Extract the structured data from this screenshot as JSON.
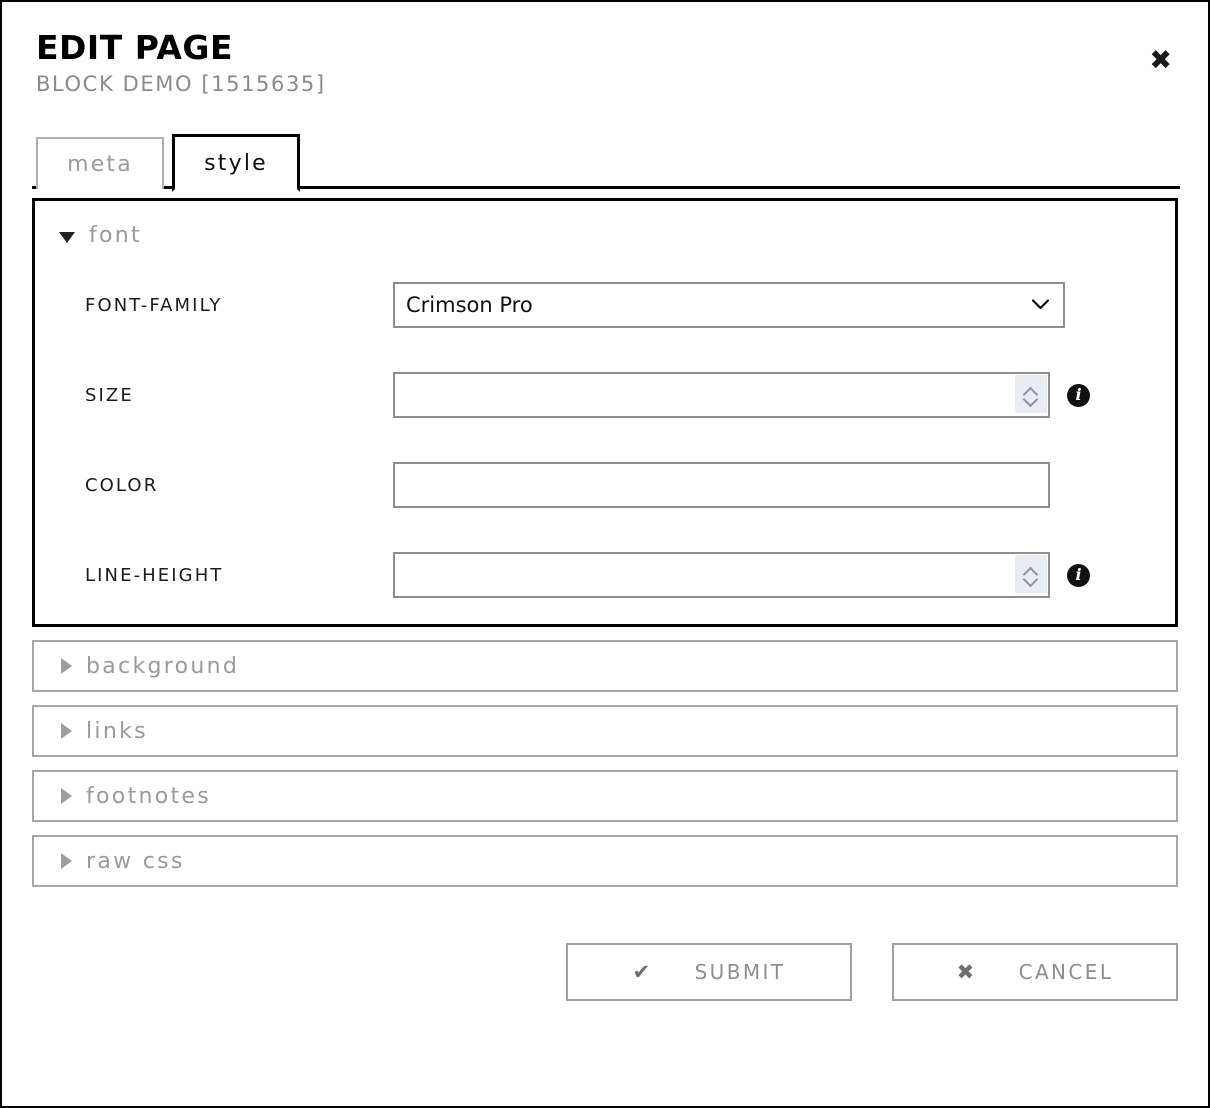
{
  "dialog": {
    "title": "EDIT PAGE",
    "subtitle": "BLOCK DEMO [1515635]",
    "close_label": "✖"
  },
  "tabs": [
    {
      "label": "meta",
      "active": false
    },
    {
      "label": "style",
      "active": true
    }
  ],
  "style_tab": {
    "open_section": {
      "name": "font",
      "marker": "▼",
      "fields": [
        {
          "label": "FONT-FAMILY",
          "type": "select",
          "value": "Crimson Pro",
          "chevron": "⌄",
          "has_info": false,
          "options": [
            "Crimson Pro"
          ]
        },
        {
          "label": "SIZE",
          "type": "number",
          "value": "",
          "placeholder": "",
          "has_info": true,
          "info_glyph": "i"
        },
        {
          "label": "COLOR",
          "type": "text",
          "value": "",
          "placeholder": "",
          "has_info": false
        },
        {
          "label": "LINE-HEIGHT",
          "type": "number",
          "value": "",
          "placeholder": "",
          "has_info": true,
          "info_glyph": "i"
        }
      ]
    },
    "closed_sections": [
      {
        "name": "background",
        "marker": "▶"
      },
      {
        "name": "links",
        "marker": "▶"
      },
      {
        "name": "footnotes",
        "marker": "▶"
      },
      {
        "name": "raw css",
        "marker": "▶"
      }
    ]
  },
  "footer": {
    "submit_label": "SUBMIT",
    "submit_icon": "✔",
    "cancel_label": "CANCEL",
    "cancel_icon": "✖"
  },
  "colors": {
    "text_primary": "#000000",
    "text_muted": "#9a9a9a",
    "border_active": "#000000",
    "border_muted": "#a6a6a6",
    "spinner_bg": "#e9ecf2"
  }
}
